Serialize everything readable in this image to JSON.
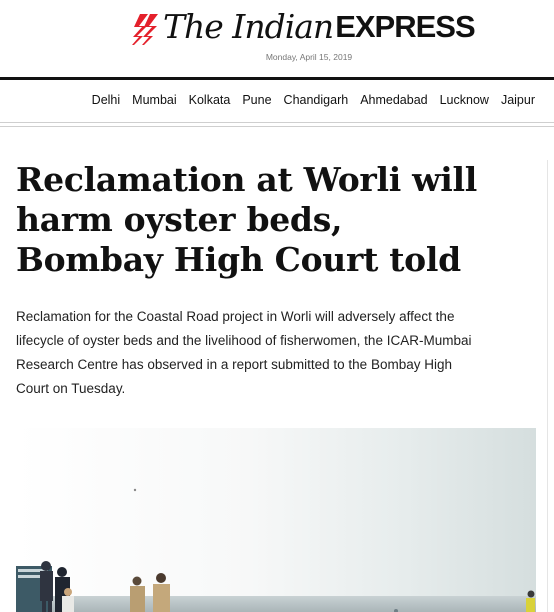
{
  "masthead": {
    "brand_the": "The Indian",
    "brand_express": "EXPRESS",
    "date": "Monday, April 15, 2019",
    "brand_color": "#e4202b"
  },
  "nav": {
    "cities": [
      "Delhi",
      "Mumbai",
      "Kolkata",
      "Pune",
      "Chandigarh",
      "Ahmedabad",
      "Lucknow",
      "Jaipur"
    ]
  },
  "article": {
    "headline": "Reclamation at Worli will harm oyster beds, Bombay High Court told",
    "summary": "Reclamation for the Coastal Road project in Worli will adversely affect the lifecycle of oyster beds and the livelihood of fisherwomen, the ICAR-Mumbai Research Centre has observed in a report submitted to the Bombay High Court on Tuesday."
  },
  "photo": {
    "description_icon": "news-photo-image"
  }
}
